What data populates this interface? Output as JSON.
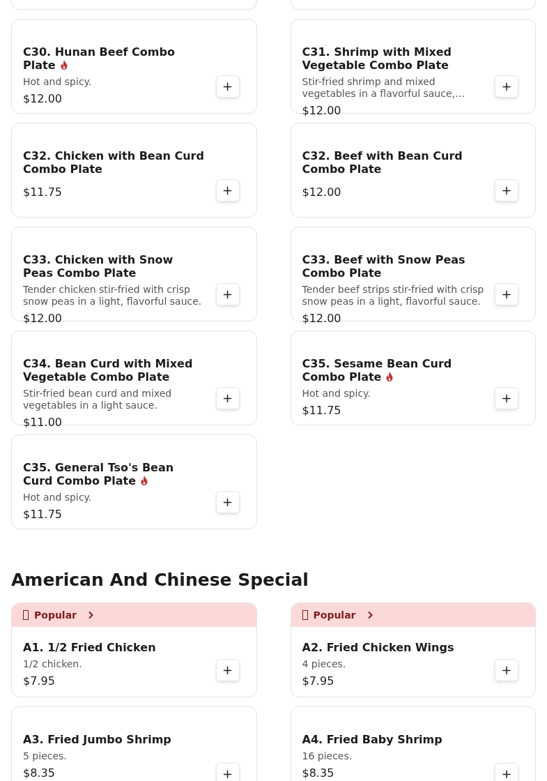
{
  "sections": [
    {
      "items": [
        {
          "kind": "cut_off"
        },
        {
          "kind": "cut_off"
        },
        {
          "kind": "dish",
          "name": "C30. Hunan Beef Combo Plate",
          "spicy": true,
          "description": "Hot and spicy.",
          "price": "$12.00",
          "button": "+"
        },
        {
          "kind": "dish",
          "name": "C31. Shrimp with Mixed Vegetable Combo Plate",
          "spicy": false,
          "description": "Stir-fried shrimp and mixed vegetables in a flavorful sauce,…",
          "price": "$12.00",
          "button": "+"
        },
        {
          "kind": "dish",
          "name": "C32. Chicken with Bean Curd Combo Plate",
          "spicy": false,
          "price": "$11.75",
          "button": "+"
        },
        {
          "kind": "dish",
          "name": "C32. Beef with Bean Curd Combo Plate",
          "spicy": false,
          "price": "$12.00",
          "button": "+"
        },
        {
          "kind": "dish",
          "name": "C33. Chicken with Snow Peas Combo Plate",
          "spicy": false,
          "description": "Tender chicken stir-fried with crisp snow peas in a light, flavorful sauce.",
          "price": "$12.00",
          "button": "+"
        },
        {
          "kind": "dish",
          "name": "C33. Beef with Snow Peas Combo Plate",
          "spicy": false,
          "description": "Tender beef strips stir-fried with crisp snow peas in a light, flavorful sauce.",
          "price": "$12.00",
          "button": "+"
        },
        {
          "kind": "dish",
          "name": "C34. Bean Curd with Mixed Vegetable Combo Plate",
          "spicy": false,
          "description": "Stir-fried bean curd and mixed vegetables in a light sauce.",
          "price": "$11.00",
          "button": "+"
        },
        {
          "kind": "dish",
          "name": "C35. Sesame Bean Curd Combo Plate",
          "spicy": true,
          "description": "Hot and spicy.",
          "price": "$11.75",
          "button": "+"
        },
        {
          "kind": "dish",
          "name": "C35. General Tso's Bean Curd Combo Plate",
          "spicy": true,
          "description": "Hot and spicy.",
          "price": "$11.75",
          "button": "+"
        }
      ]
    },
    {
      "title": "American And Chinese Special",
      "items": [
        {
          "kind": "dish",
          "badge": {
            "label": "Popular"
          },
          "name": "A1. 1/2 Fried Chicken",
          "spicy": false,
          "description": "1/2 chicken.",
          "price": "$7.95",
          "button": "+"
        },
        {
          "kind": "dish",
          "badge": {
            "label": "Popular"
          },
          "name": "A2. Fried Chicken Wings",
          "spicy": false,
          "description": "4 pieces.",
          "price": "$7.95",
          "button": "+"
        },
        {
          "kind": "dish",
          "name": "A3. Fried Jumbo Shrimp",
          "spicy": false,
          "description": "5 pieces.",
          "price": "$8.35",
          "button": "+"
        },
        {
          "kind": "dish",
          "name": "A4. Fried Baby Shrimp",
          "spicy": false,
          "description": "16 pieces.",
          "price": "$8.35",
          "button": "+"
        }
      ]
    }
  ]
}
